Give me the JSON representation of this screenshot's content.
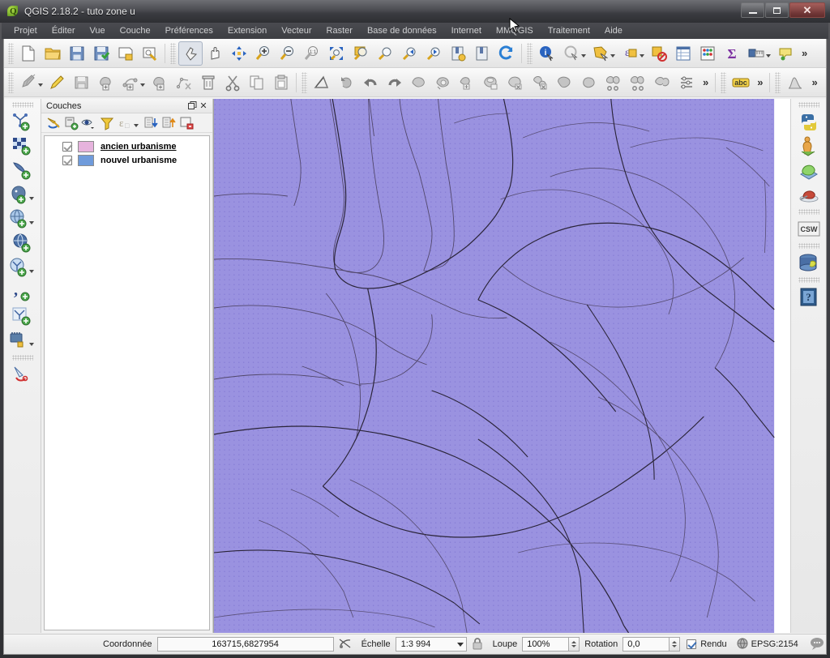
{
  "window": {
    "title": "QGIS 2.18.2 - tuto zone u",
    "app_icon": "qgis-leaf-icon",
    "controls": {
      "minimize": "minimize-button",
      "maximize": "maximize-button",
      "close": "close-button"
    }
  },
  "menubar": {
    "items": [
      {
        "label": "Projet"
      },
      {
        "label": "Éditer"
      },
      {
        "label": "Vue"
      },
      {
        "label": "Couche"
      },
      {
        "label": "Préférences"
      },
      {
        "label": "Extension"
      },
      {
        "label": "Vecteur"
      },
      {
        "label": "Raster"
      },
      {
        "label": "Base de données"
      },
      {
        "label": "Internet"
      },
      {
        "label": "MMQGIS"
      },
      {
        "label": "Traitement"
      },
      {
        "label": "Aide"
      }
    ]
  },
  "toolbars": {
    "row1": {
      "project_group": [
        {
          "icon": "new-project-icon",
          "tooltip": "Nouveau projet"
        },
        {
          "icon": "open-project-icon",
          "tooltip": "Ouvrir un projet"
        },
        {
          "icon": "save-project-icon",
          "tooltip": "Enregistrer le projet"
        },
        {
          "icon": "save-project-as-icon",
          "tooltip": "Enregistrer le projet sous"
        },
        {
          "icon": "new-print-composer-icon",
          "tooltip": "Nouveau composeur d'impression"
        },
        {
          "icon": "composer-manager-icon",
          "tooltip": "Gestionnaire de composeurs"
        }
      ],
      "navigation_group": [
        {
          "icon": "pan-map-icon",
          "tooltip": "Déplacer la carte",
          "state": "pressed"
        },
        {
          "icon": "pan-to-selection-icon",
          "tooltip": "Déplacer la carte sur la sélection"
        },
        {
          "icon": "zoom-full-icon",
          "tooltip": "Zoom complet"
        },
        {
          "icon": "zoom-in-icon",
          "tooltip": "Zoom avant"
        },
        {
          "icon": "zoom-out-icon",
          "tooltip": "Zoom arrière"
        },
        {
          "icon": "zoom-native-icon",
          "tooltip": "Zoom à la résolution native 1:1"
        },
        {
          "icon": "zoom-to-layer-icon",
          "tooltip": "Zoom sur la couche"
        },
        {
          "icon": "zoom-to-selection-icon",
          "tooltip": "Zoom sur la sélection"
        },
        {
          "icon": "zoom-last-icon",
          "tooltip": "Zoom précédent"
        },
        {
          "icon": "zoom-next-icon",
          "tooltip": "Zoom suivant"
        },
        {
          "icon": "zoom-previous-icon",
          "tooltip": "Vue précédente"
        },
        {
          "icon": "zoom-forward-icon",
          "tooltip": "Vue suivante"
        },
        {
          "icon": "new-bookmark-icon",
          "tooltip": "Nouveau signet"
        },
        {
          "icon": "show-bookmarks-icon",
          "tooltip": "Afficher les signets"
        },
        {
          "icon": "refresh-icon",
          "tooltip": "Rafraîchir"
        }
      ],
      "attributes_group": [
        {
          "icon": "identify-features-icon",
          "tooltip": "Identifier les entités"
        },
        {
          "icon": "select-features-icon",
          "tooltip": "Sélectionner les entités",
          "has_menu": true
        },
        {
          "icon": "select-by-polygon-icon",
          "tooltip": "Sélection par polygone",
          "has_menu": true
        },
        {
          "icon": "select-by-expression-icon",
          "tooltip": "Sélectionner par expression",
          "has_menu": true
        },
        {
          "icon": "deselect-features-icon",
          "tooltip": "Désélectionner les entités"
        },
        {
          "icon": "open-attribute-table-icon",
          "tooltip": "Ouvrir la table d'attributs"
        },
        {
          "icon": "field-calculator-icon",
          "tooltip": "Calculatrice de champ"
        },
        {
          "icon": "statistical-summary-icon",
          "tooltip": "Résumé statistique"
        },
        {
          "icon": "measure-line-icon",
          "tooltip": "Mesurer une ligne",
          "has_menu": true
        },
        {
          "icon": "map-tips-icon",
          "tooltip": "Infobulles de carte"
        }
      ],
      "overflow": "»"
    },
    "row2": {
      "digitizing_group": [
        {
          "icon": "current-edits-icon",
          "tooltip": "Édition en cours",
          "has_menu": true
        },
        {
          "icon": "toggle-editing-icon",
          "tooltip": "Basculer en mode édition"
        },
        {
          "icon": "save-layer-edits-icon",
          "tooltip": "Enregistrer les modifications"
        },
        {
          "icon": "add-feature-icon",
          "tooltip": "Ajouter une entité"
        },
        {
          "icon": "add-circular-string-icon",
          "tooltip": "Ajouter une chaîne circulaire",
          "has_menu": true
        },
        {
          "icon": "move-feature-icon",
          "tooltip": "Déplacer l'entité"
        },
        {
          "icon": "node-tool-icon",
          "tooltip": "Outil de nœud"
        },
        {
          "icon": "delete-selected-icon",
          "tooltip": "Supprimer la sélection"
        },
        {
          "icon": "cut-features-icon",
          "tooltip": "Couper les entités"
        },
        {
          "icon": "copy-features-icon",
          "tooltip": "Copier les entités"
        },
        {
          "icon": "paste-features-icon",
          "tooltip": "Coller les entités"
        }
      ],
      "advanced_group": [
        {
          "icon": "enable-tracing-icon",
          "tooltip": "Activer le traçage"
        },
        {
          "icon": "rotate-feature-icon",
          "tooltip": "Rotation de l'entité"
        },
        {
          "icon": "undo-icon",
          "tooltip": "Annuler"
        },
        {
          "icon": "redo-icon",
          "tooltip": "Rétablir"
        },
        {
          "icon": "simplify-feature-icon",
          "tooltip": "Simplifier l'entité"
        },
        {
          "icon": "add-ring-icon",
          "tooltip": "Ajouter un anneau"
        },
        {
          "icon": "add-part-icon",
          "tooltip": "Ajouter une partie"
        },
        {
          "icon": "fill-ring-icon",
          "tooltip": "Remplir l'anneau"
        },
        {
          "icon": "delete-ring-icon",
          "tooltip": "Supprimer l'anneau"
        },
        {
          "icon": "delete-part-icon",
          "tooltip": "Supprimer la partie"
        },
        {
          "icon": "reshape-features-icon",
          "tooltip": "Remodeler les entités"
        },
        {
          "icon": "offset-curve-icon",
          "tooltip": "Décaler une courbe"
        },
        {
          "icon": "split-features-icon",
          "tooltip": "Séparer les entités"
        },
        {
          "icon": "split-parts-icon",
          "tooltip": "Séparer les parties"
        },
        {
          "icon": "merge-features-icon",
          "tooltip": "Fusionner les entités"
        },
        {
          "icon": "merge-attributes-icon",
          "tooltip": "Fusionner les attributs"
        }
      ],
      "label_group": [
        {
          "icon": "label-abc-icon",
          "tooltip": "Étiquetage"
        }
      ],
      "raster_group": [
        {
          "icon": "histogram-stretch-icon",
          "tooltip": "Étirement d'histogramme"
        }
      ],
      "overflow": "»"
    },
    "left_vertical": [
      {
        "icon": "add-vector-layer-icon",
        "tooltip": "Ajouter une couche vecteur"
      },
      {
        "icon": "add-raster-layer-icon",
        "tooltip": "Ajouter une couche raster"
      },
      {
        "icon": "add-spatialite-layer-icon",
        "tooltip": "Ajouter une couche SpatiaLite"
      },
      {
        "icon": "add-postgis-layer-icon",
        "tooltip": "Ajouter une couche PostGIS",
        "has_menu": true
      },
      {
        "icon": "add-wms-layer-icon",
        "tooltip": "Ajouter une couche WMS/WMTS",
        "has_menu": true
      },
      {
        "icon": "add-wcs-layer-icon",
        "tooltip": "Ajouter une couche WCS"
      },
      {
        "icon": "add-wfs-layer-icon",
        "tooltip": "Ajouter une couche WFS",
        "has_menu": true
      },
      {
        "icon": "add-delimited-text-layer-icon",
        "tooltip": "Ajouter une couche de texte délimité"
      },
      {
        "icon": "new-shapefile-layer-icon",
        "tooltip": "Nouvelle couche shapefile"
      },
      {
        "icon": "add-virtual-layer-icon",
        "tooltip": "Ajouter une couche virtuelle",
        "has_menu": true
      },
      {
        "icon": "style-manager-icon",
        "tooltip": "Gestionnaire de styles"
      }
    ],
    "right_vertical": [
      {
        "icon": "python-console-icon",
        "tooltip": "Console Python"
      },
      {
        "icon": "georeferencer-icon",
        "tooltip": "Géoréférenceur"
      },
      {
        "icon": "openlayers-plugin-icon",
        "tooltip": "OpenLayers"
      },
      {
        "icon": "qgis2web-icon",
        "tooltip": "qgis2web"
      },
      {
        "icon": "csw-catalog-icon",
        "tooltip": "CSW",
        "label": "CSW"
      },
      {
        "icon": "database-manager-icon",
        "tooltip": "Gestionnaire de bases de données"
      },
      {
        "icon": "help-icon",
        "tooltip": "Aide"
      }
    ]
  },
  "panel": {
    "title": "Couches",
    "float_icon": "float-panel-icon",
    "close_icon": "close-panel-icon",
    "toolbar": [
      {
        "icon": "layer-styling-icon",
        "tooltip": "Panneau de style de couche"
      },
      {
        "icon": "add-group-icon",
        "tooltip": "Ajouter un groupe"
      },
      {
        "icon": "manage-layer-visibility-icon",
        "tooltip": "Gérer la visibilité des couches",
        "has_menu": true
      },
      {
        "icon": "filter-legend-icon",
        "tooltip": "Filtrer la légende par contenu de la carte"
      },
      {
        "icon": "filter-legend-expression-icon",
        "tooltip": "Filtrer la légende par expression",
        "has_menu": true
      },
      {
        "icon": "collapse-all-icon",
        "tooltip": "Tout réduire"
      },
      {
        "icon": "expand-all-icon",
        "tooltip": "Tout développer"
      },
      {
        "icon": "remove-layer-icon",
        "tooltip": "Supprimer la couche/le groupe"
      }
    ],
    "layers": [
      {
        "name": "ancien urbanisme",
        "checked": true,
        "color": "#e6b3dd",
        "selected": true
      },
      {
        "name": "nouvel urbanisme",
        "checked": true,
        "color": "#6f9bdb",
        "selected": false
      }
    ]
  },
  "map": {
    "fill_color": "#9a92e0",
    "stroke_color": "#4a3f5e",
    "stroke_color_dark": "#221d30",
    "background": "#ffffff"
  },
  "statusbar": {
    "coordinate_label": "Coordonnée",
    "coordinate_value": "163715,6827954",
    "toggle_extents_icon": "toggle-extents-icon",
    "scale_label": "Échelle",
    "scale_value": "1:3 994",
    "lock_icon": "lock-scale-icon",
    "magnifier_label": "Loupe",
    "magnifier_value": "100%",
    "rotation_label": "Rotation",
    "rotation_value": "0,0",
    "render_label": "Rendu",
    "render_checked": true,
    "crs_icon": "crs-globe-icon",
    "crs_value": "EPSG:2154",
    "messages_icon": "messages-log-icon"
  }
}
